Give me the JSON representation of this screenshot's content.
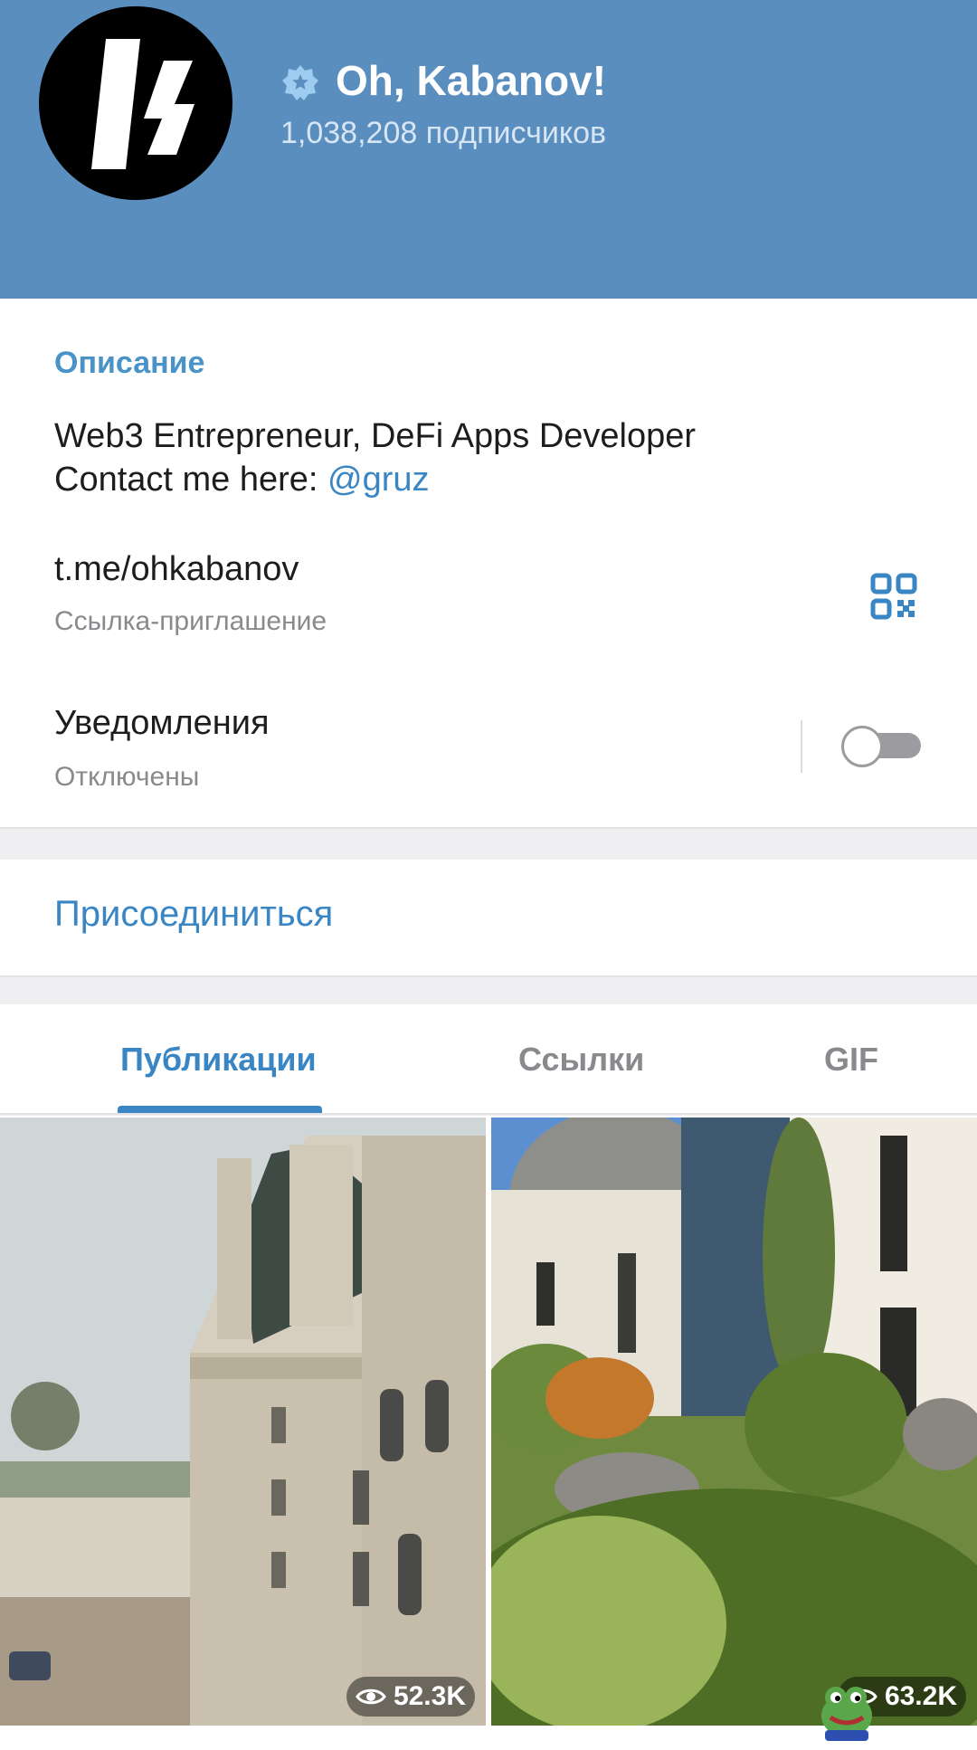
{
  "channel": {
    "name": "Oh, Kabanov!",
    "subscribers": "1,038,208 подписчиков",
    "verified_icon": "verified-badge-icon",
    "colors": {
      "header": "#5a8ebf",
      "accent": "#3a86c4"
    }
  },
  "info": {
    "description_title": "Описание",
    "description_line1": "Web3 Entrepreneur, DeFi Apps Developer",
    "description_line2_prefix": "Contact me here: ",
    "description_mention": "@gruz",
    "link": "t.me/ohkabanov",
    "link_subtitle": "Ссылка-приглашение",
    "notifications_label": "Уведомления",
    "notifications_state": "Отключены",
    "notifications_enabled": false
  },
  "actions": {
    "join_label": "Присоединиться"
  },
  "tabs": [
    {
      "label": "Публикации",
      "active": true
    },
    {
      "label": "Ссылки",
      "active": false
    },
    {
      "label": "GIF",
      "active": false
    }
  ],
  "media": [
    {
      "views": "52.3K"
    },
    {
      "views": "63.2K"
    }
  ]
}
